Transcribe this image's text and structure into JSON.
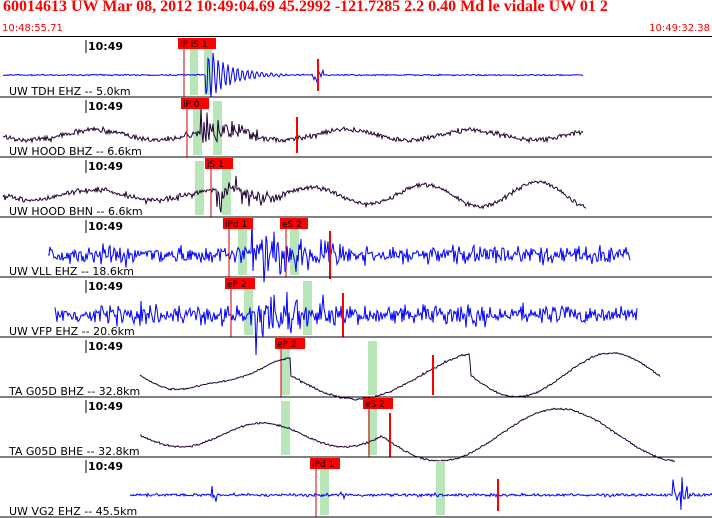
{
  "header": {
    "title": "60014613 UW Mar 08, 2012 10:49:04.69    45.2992 -121.7285  2.2 0.40 Md le vidale UW 01   2",
    "start_time": "10:48:55.71",
    "end_time": "10:49:32.38"
  },
  "colors": {
    "header_red": "#ff0000",
    "trace_blue": "#0000ff",
    "trace_dark": "#200030",
    "pick_fill": "#ff0000",
    "window_green": "#b8e6b8",
    "frame": "#000000"
  },
  "panels": [
    {
      "time_label": "10:49",
      "station_label": "UW TDH EHZ -- 5.0km",
      "trace_color": "blue",
      "picks": [
        {
          "label": "iP iS 1"
        }
      ]
    },
    {
      "time_label": "10:49",
      "station_label": "UW HOOD BHZ -- 6.6km",
      "trace_color": "dark",
      "picks": [
        {
          "label": "iP 0"
        }
      ]
    },
    {
      "time_label": "10:49",
      "station_label": "UW HOOD BHN -- 6.6km",
      "trace_color": "dark",
      "picks": [
        {
          "label": "iS 1"
        }
      ]
    },
    {
      "time_label": "10:49",
      "station_label": "UW VLL EHZ -- 18.6km",
      "trace_color": "blue",
      "picks": [
        {
          "label": "iPd 1"
        },
        {
          "label": "eS 2"
        }
      ]
    },
    {
      "time_label": "10:49",
      "station_label": "UW VFP EHZ -- 20.6km",
      "trace_color": "blue",
      "picks": [
        {
          "label": "eP 2"
        }
      ]
    },
    {
      "time_label": "10:49",
      "station_label": "TA G05D BHZ -- 32.8km",
      "trace_color": "dark",
      "picks": [
        {
          "label": "eP 2"
        }
      ]
    },
    {
      "time_label": "10:49",
      "station_label": "TA G05D BHE -- 32.8km",
      "trace_color": "dark",
      "picks": [
        {
          "label": "eS 2"
        }
      ]
    },
    {
      "time_label": "10:49",
      "station_label": "UW VG2 EHZ -- 45.5km",
      "trace_color": "blue",
      "picks": [
        {
          "label": "iPd 1"
        }
      ]
    }
  ]
}
